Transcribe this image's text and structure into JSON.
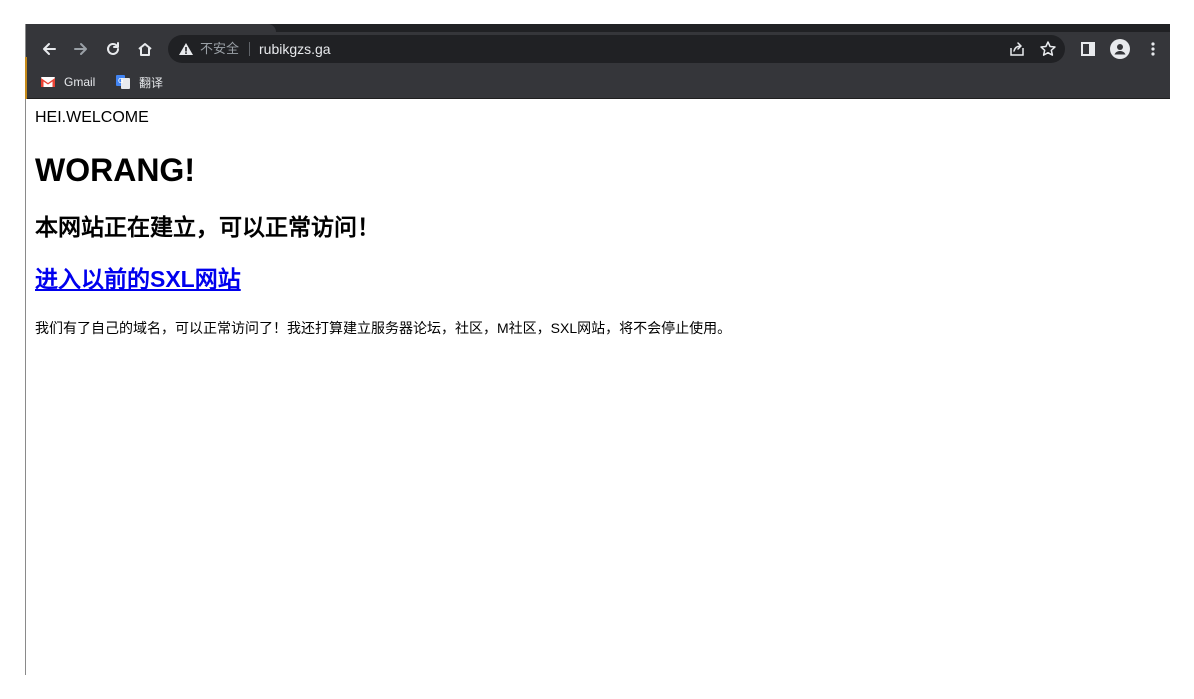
{
  "browser": {
    "security_label": "不安全",
    "url": "rubikgzs.ga",
    "bookmarks": [
      {
        "label": "Gmail",
        "icon": "gmail-icon"
      },
      {
        "label": "翻译",
        "icon": "translate-icon"
      }
    ],
    "colors": {
      "toolbar": "#35363a",
      "omnibox": "#202124",
      "icon": "#e8eaed"
    }
  },
  "page": {
    "intro": "HEI.WELCOME",
    "heading": "WORANG!",
    "subheading": "本网站正在建立，可以正常访问！",
    "link": "进入以前的SXL网站",
    "paragraph": "我们有了自己的域名，可以正常访问了！我还打算建立服务器论坛，社区，M社区，SXL网站，将不会停止使用。",
    "link_color": "#0000ee"
  }
}
